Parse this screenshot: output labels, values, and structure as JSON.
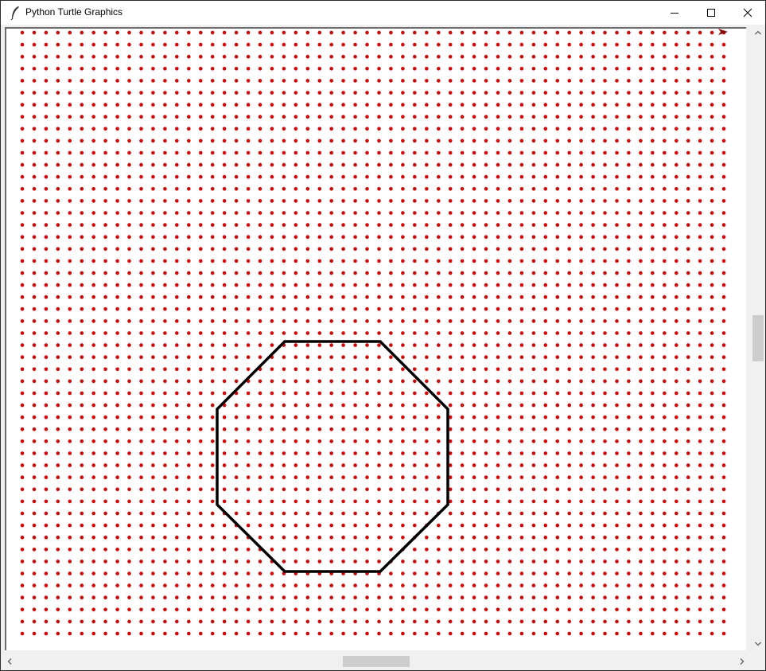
{
  "window": {
    "title": "Python Turtle Graphics",
    "controls": {
      "minimize": "minimize-icon",
      "maximize": "maximize-icon",
      "close": "close-icon"
    }
  },
  "canvas": {
    "background": "#ffffff",
    "dot_color": "#e00000",
    "shape": "octagon",
    "shape_color": "#000000",
    "turtle_color": "#8b0000"
  },
  "scrollbars": {
    "vertical": {
      "up": "chevron-up-icon",
      "down": "chevron-down-icon",
      "position": 0.48
    },
    "horizontal": {
      "left": "chevron-left-icon",
      "right": "chevron-right-icon",
      "position": 0.5
    }
  }
}
